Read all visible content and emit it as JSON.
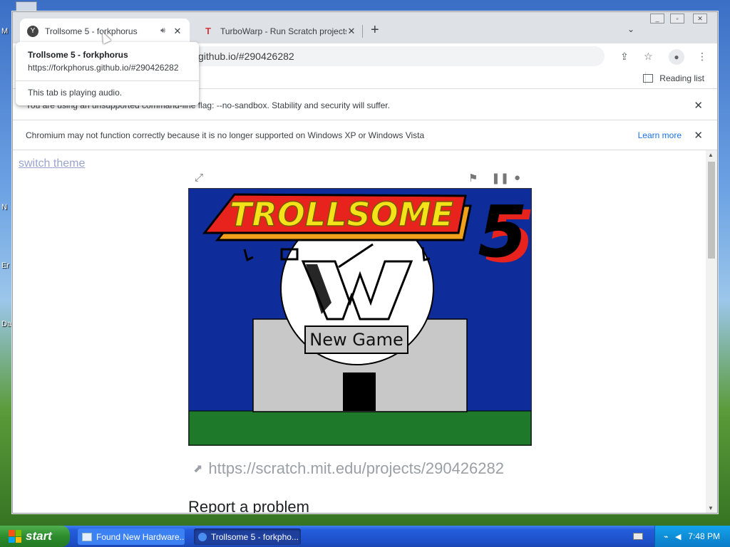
{
  "desktop": {
    "labels": [
      "M",
      "N",
      "Er",
      "Da"
    ]
  },
  "browser": {
    "tabs": [
      {
        "title": "Trollsome 5 - forkphorus",
        "active": true,
        "audio": true
      },
      {
        "title": "TurboWarp - Run Scratch projects faster",
        "active": false
      }
    ],
    "new_tab_label": "+",
    "omnibox_url": "github.io/#290426282",
    "reading_list_label": "Reading list",
    "hover_card": {
      "title": "Trollsome 5 - forkphorus",
      "url": "https://forkphorus.github.io/#290426282",
      "status": "This tab is playing audio."
    },
    "infobars": [
      {
        "text": "You are using an unsupported command-line flag: --no-sandbox. Stability and security will suffer."
      },
      {
        "text": "Chromium may not function correctly because it is no longer supported on Windows XP or Windows Vista",
        "link": "Learn more"
      }
    ]
  },
  "page": {
    "switch_theme": "switch theme",
    "game": {
      "title": "TROLLSOME",
      "number": "5",
      "button_label": "New Game"
    },
    "project_link": "https://scratch.mit.edu/projects/290426282",
    "report_problem": "Report a problem"
  },
  "taskbar": {
    "start_label": "start",
    "buttons": [
      {
        "label": "Found New Hardware..."
      },
      {
        "label": "Trollsome 5 - forkpho..."
      }
    ],
    "clock": "7:48 PM"
  },
  "colors": {
    "stage_sky": "#0e2d9a",
    "stage_ground": "#1e7a2a",
    "title_red": "#e8231d",
    "title_yellow": "#f5e31a",
    "link_blue": "#1a73e8",
    "taskbar_blue": "#245ddc"
  }
}
